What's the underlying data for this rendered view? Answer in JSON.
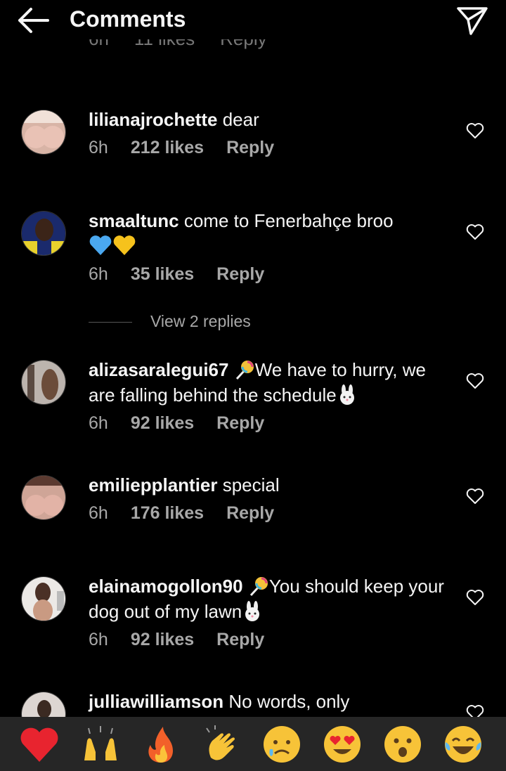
{
  "header": {
    "title": "Comments"
  },
  "ghost_row": {
    "time": "6h",
    "likes": "11 likes",
    "reply": "Reply"
  },
  "comments": [
    {
      "username": "lilianajrochette",
      "text": " dear",
      "text2": "",
      "time": "6h",
      "likes": "212 likes",
      "reply": "Reply"
    },
    {
      "username": "smaaltunc",
      "text": " come to Fenerbahçe broo",
      "text2": "",
      "time": "6h",
      "likes": "35 likes",
      "reply": "Reply"
    },
    {
      "username": "alizasaralegui67",
      "text": "We have to hurry, we are falling behind the schedule",
      "text2": "",
      "time": "6h",
      "likes": "92 likes",
      "reply": "Reply"
    },
    {
      "username": "emiliepplantier",
      "text": " special",
      "text2": "",
      "time": "6h",
      "likes": "176 likes",
      "reply": "Reply"
    },
    {
      "username": "elainamogollon90",
      "text": "You should keep your dog out of my lawn",
      "text2": "",
      "time": "6h",
      "likes": "92 likes",
      "reply": "Reply"
    },
    {
      "username": "julliawilliamson",
      "text": " No words, only",
      "text2": "",
      "time": "",
      "likes": "",
      "reply": ""
    }
  ],
  "view_replies": "View 2 replies",
  "icons": {
    "back": "arrow-left-icon",
    "send": "paper-plane-icon",
    "heart": "heart-outline-icon"
  },
  "emoji_bar": [
    "red-heart",
    "raising-hands",
    "fire",
    "clapping-hands",
    "sad-relieved-face",
    "heart-eyes",
    "astonished-face",
    "tears-of-joy"
  ],
  "colors": {
    "background": "#000000",
    "text": "#f5f5f5",
    "meta": "#a8a8a8",
    "emoji_bar_bg": "#262626"
  }
}
